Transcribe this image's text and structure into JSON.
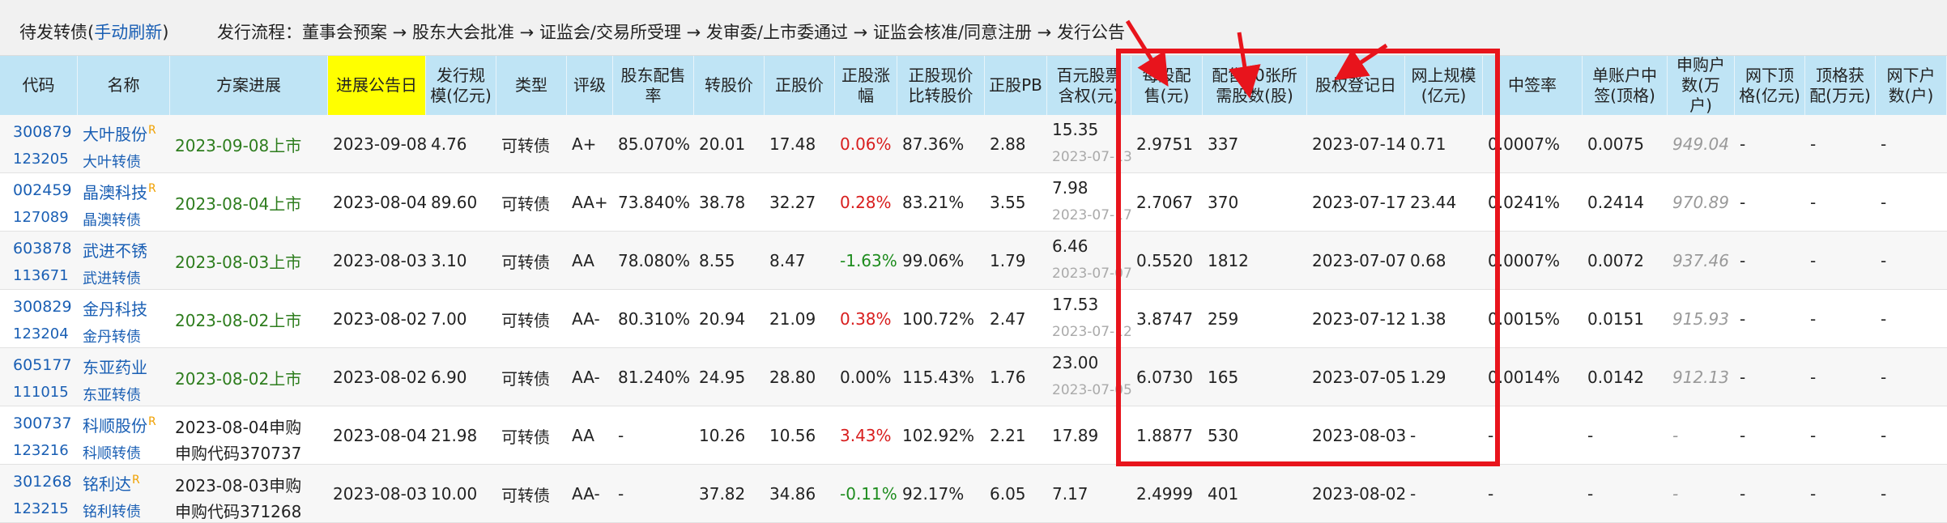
{
  "topbar": {
    "title": "待发转债(",
    "refresh": "手动刷新",
    "title_end": ")",
    "flow": "发行流程：董事会预案 → 股东大会批准 → 证监会/交易所受理 → 发审委/上市委通过 → 证监会核准/同意注册 → 发行公告"
  },
  "headers": {
    "code": "代码",
    "name": "名称",
    "plan": "方案进展",
    "date": "进展公告日",
    "size": "发行规模(亿元)",
    "type": "类型",
    "rating": "评级",
    "ratio": "股东配售率",
    "conv": "转股价",
    "price": "正股价",
    "chg": "正股涨幅",
    "pct": "正股现价比转股价",
    "pb": "正股PB",
    "perbai": "百元股票含权(元)",
    "each": "每股配售(元)",
    "need": "配售10张所需股数(股)",
    "reg": "股权登记日",
    "online": "网上规模(亿元)",
    "win": "中签率",
    "single": "单账户中签(顶格)",
    "apply": "申购户数(万户)",
    "offtop": "网下顶格(亿元)",
    "topget": "顶格获配(万元)",
    "offcnt": "网下户数(户)"
  },
  "rows": [
    {
      "code": "300879",
      "bcode": "123205",
      "name": "大叶股份",
      "bname": "大叶转债",
      "sup": "R",
      "plan": "2023-09-08上市",
      "plan2": "",
      "green": true,
      "date": "2023-09-08",
      "size": "4.76",
      "type": "可转债",
      "rating": "A+",
      "ratio": "85.070%",
      "conv": "20.01",
      "price": "17.48",
      "chg": "0.06%",
      "chgc": "red",
      "pct": "87.36%",
      "pb": "2.88",
      "perbai": "15.35",
      "perdate": "2023-07-13",
      "each": "2.9751",
      "need": "337",
      "reg": "2023-07-14",
      "online": "0.71",
      "win": "0.0007%",
      "single": "0.0075",
      "apply": "949.04",
      "offtop": "-",
      "topget": "-",
      "offcnt": "-"
    },
    {
      "code": "002459",
      "bcode": "127089",
      "name": "晶澳科技",
      "bname": "晶澳转债",
      "sup": "R",
      "plan": "2023-08-04上市",
      "plan2": "",
      "green": true,
      "date": "2023-08-04",
      "size": "89.60",
      "type": "可转债",
      "rating": "AA+",
      "ratio": "73.840%",
      "conv": "38.78",
      "price": "32.27",
      "chg": "0.28%",
      "chgc": "red",
      "pct": "83.21%",
      "pb": "3.55",
      "perbai": "7.98",
      "perdate": "2023-07-17",
      "each": "2.7067",
      "need": "370",
      "reg": "2023-07-17",
      "online": "23.44",
      "win": "0.0241%",
      "single": "0.2414",
      "apply": "970.89",
      "offtop": "-",
      "topget": "-",
      "offcnt": "-"
    },
    {
      "code": "603878",
      "bcode": "113671",
      "name": "武进不锈",
      "bname": "武进转债",
      "sup": "",
      "plan": "2023-08-03上市",
      "plan2": "",
      "green": true,
      "date": "2023-08-03",
      "size": "3.10",
      "type": "可转债",
      "rating": "AA",
      "ratio": "78.080%",
      "conv": "8.55",
      "price": "8.47",
      "chg": "-1.63%",
      "chgc": "green",
      "pct": "99.06%",
      "pb": "1.79",
      "perbai": "6.46",
      "perdate": "2023-07-07",
      "each": "0.5520",
      "need": "1812",
      "reg": "2023-07-07",
      "online": "0.68",
      "win": "0.0007%",
      "single": "0.0072",
      "apply": "937.46",
      "offtop": "-",
      "topget": "-",
      "offcnt": "-"
    },
    {
      "code": "300829",
      "bcode": "123204",
      "name": "金丹科技",
      "bname": "金丹转债",
      "sup": "",
      "plan": "2023-08-02上市",
      "plan2": "",
      "green": true,
      "date": "2023-08-02",
      "size": "7.00",
      "type": "可转债",
      "rating": "AA-",
      "ratio": "80.310%",
      "conv": "20.94",
      "price": "21.09",
      "chg": "0.38%",
      "chgc": "red",
      "pct": "100.72%",
      "pb": "2.47",
      "perbai": "17.53",
      "perdate": "2023-07-12",
      "each": "3.8747",
      "need": "259",
      "reg": "2023-07-12",
      "online": "1.38",
      "win": "0.0015%",
      "single": "0.0151",
      "apply": "915.93",
      "offtop": "-",
      "topget": "-",
      "offcnt": "-"
    },
    {
      "code": "605177",
      "bcode": "111015",
      "name": "东亚药业",
      "bname": "东亚转债",
      "sup": "",
      "plan": "2023-08-02上市",
      "plan2": "",
      "green": true,
      "date": "2023-08-02",
      "size": "6.90",
      "type": "可转债",
      "rating": "AA-",
      "ratio": "81.240%",
      "conv": "24.95",
      "price": "28.80",
      "chg": "0.00%",
      "chgc": "",
      "pct": "115.43%",
      "pb": "1.76",
      "perbai": "23.00",
      "perdate": "2023-07-05",
      "each": "6.0730",
      "need": "165",
      "reg": "2023-07-05",
      "online": "1.29",
      "win": "0.0014%",
      "single": "0.0142",
      "apply": "912.13",
      "offtop": "-",
      "topget": "-",
      "offcnt": "-"
    },
    {
      "code": "300737",
      "bcode": "123216",
      "name": "科顺股份",
      "bname": "科顺转债",
      "sup": "R",
      "plan": "2023-08-04申购",
      "plan2": "申购代码370737",
      "green": false,
      "date": "2023-08-04",
      "size": "21.98",
      "type": "可转债",
      "rating": "AA",
      "ratio": "-",
      "conv": "10.26",
      "price": "10.56",
      "chg": "3.43%",
      "chgc": "red",
      "pct": "102.92%",
      "pb": "2.21",
      "perbai": "17.89",
      "perdate": "",
      "each": "1.8877",
      "need": "530",
      "reg": "2023-08-03",
      "online": "-",
      "win": "-",
      "single": "-",
      "apply": "-",
      "offtop": "-",
      "topget": "-",
      "offcnt": "-"
    },
    {
      "code": "301268",
      "bcode": "123215",
      "name": "铭利达",
      "bname": "铭利转债",
      "sup": "R",
      "plan": "2023-08-03申购",
      "plan2": "申购代码371268",
      "green": false,
      "date": "2023-08-03",
      "size": "10.00",
      "type": "可转债",
      "rating": "AA-",
      "ratio": "-",
      "conv": "37.82",
      "price": "34.86",
      "chg": "-0.11%",
      "chgc": "green",
      "pct": "92.17%",
      "pb": "6.05",
      "perbai": "7.17",
      "perdate": "",
      "each": "2.4999",
      "need": "401",
      "reg": "2023-08-02",
      "online": "-",
      "win": "-",
      "single": "-",
      "apply": "-",
      "offtop": "-",
      "topget": "-",
      "offcnt": "-"
    }
  ],
  "colors": {
    "link": "#1a5fb4",
    "header_bg": "#bfe4f5",
    "highlight": "#ffff00",
    "box": "#e8141c",
    "up": "#d81e1e",
    "down": "#1e8c1e"
  }
}
